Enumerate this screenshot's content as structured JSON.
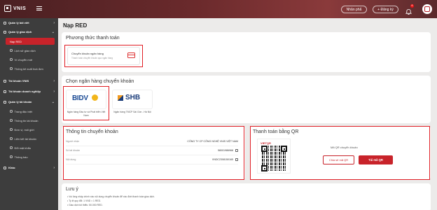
{
  "header": {
    "brand": "VNIS",
    "login_label": "Nhân phẩ",
    "register_label": "+ Đăng ký",
    "notification_count": "6"
  },
  "sidebar": {
    "items": [
      {
        "label": "Quản lý bài viết",
        "type": "group"
      },
      {
        "label": "Quản lý giao dịch",
        "type": "group"
      },
      {
        "label": "Nạp RED",
        "type": "sub",
        "active": true
      },
      {
        "label": "Lịch sử giao dịch",
        "type": "sub"
      },
      {
        "label": "Ví chuyển mới",
        "type": "sub"
      },
      {
        "label": "Thống kê xuất hoá đơn",
        "type": "sub"
      },
      {
        "label": "Tài khoản VNIS",
        "type": "group"
      },
      {
        "label": "Tài khoản doanh nghiệp",
        "type": "group"
      },
      {
        "label": "Quản lý tài khoản",
        "type": "group"
      },
      {
        "label": "Trang đặc biệt",
        "type": "sub"
      },
      {
        "label": "Thông tin tài khoản",
        "type": "sub"
      },
      {
        "label": "Đơn vị, mối giới",
        "type": "sub"
      },
      {
        "label": "Liên kết tài khoản",
        "type": "sub"
      },
      {
        "label": "Đổi mật khẩu",
        "type": "sub"
      },
      {
        "label": "Thông báo",
        "type": "sub"
      },
      {
        "label": "Khác",
        "type": "group"
      }
    ]
  },
  "page": {
    "title": "Nạp RED"
  },
  "payment_method": {
    "title": "Phương thức thanh toán",
    "option_title": "Chuyển khoản ngân hàng",
    "option_desc": "Thanh toán chuyển khoản qua ngân hàng"
  },
  "bank_select": {
    "title": "Chọn ngân hàng chuyển khoản",
    "banks": [
      {
        "logo": "BIDV",
        "name": "Ngân hàng Đầu tư và Phát triển Việt Nam"
      },
      {
        "logo": "SHB",
        "name": "Ngân hàng TMCP Sài Gòn - Hà Nội"
      }
    ]
  },
  "transfer_info": {
    "title": "Thông tin chuyển khoản",
    "rows": [
      {
        "label": "Người nhận",
        "value": "CÔNG TY CP CÔNG NGHỆ VNIS VIỆT NAM"
      },
      {
        "label": "Số tài khoản",
        "value": "58001986968"
      },
      {
        "label": "Nội dung",
        "value": "VNDC2308150165"
      }
    ]
  },
  "qr_payment": {
    "title": "Thanh toán bằng QR",
    "qr_brand": "VIETQR",
    "qr_caption": "Mã QR chuyển khoản",
    "share_label": "Chia sẻ mã QR",
    "download_label": "Tải mã QR"
  },
  "notes": {
    "title": "Lưu ý",
    "lines": [
      "Vui lòng nhập chính xác nội dung chuyển khoản để xác định thanh toán giao dịch.",
      "Tỷ lệ quy đổi: 1 VND = 1 RED.",
      "Giao dịch tối thiểu: 50.000 RED."
    ]
  },
  "colors": {
    "accent": "#c8232a",
    "sidebar": "#3d3d3d",
    "highlight": "#e01e25"
  }
}
